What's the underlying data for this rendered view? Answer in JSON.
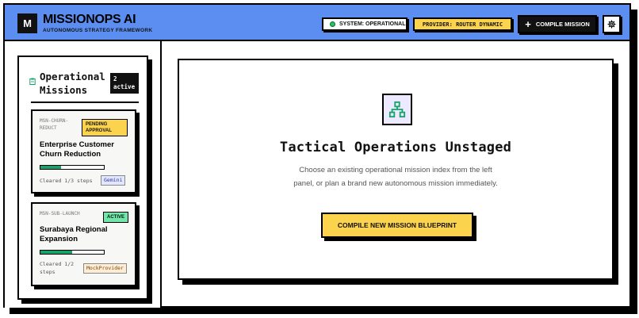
{
  "app": {
    "logo_letter": "M",
    "title": "MISSIONOPS AI",
    "subtitle": "AUTONOMOUS STRATEGY FRAMEWORK"
  },
  "header": {
    "system_status": "SYSTEM: OPERATIONAL",
    "provider": "PROVIDER: ROUTER DYNAMIC",
    "compile_label": "COMPILE MISSION",
    "settings_icon": "gear-icon"
  },
  "sidebar": {
    "title": "Operational Missions",
    "active_count": "2",
    "active_label": "active",
    "missions": [
      {
        "id": "MSN-CHURN-REDUCT",
        "badge": "PENDING APPROVAL",
        "badge_color": "#fcd34d",
        "title": "Enterprise Customer Churn Reduction",
        "progress": 0.33,
        "steps": "Cleared 1/3 steps",
        "provider": "Gemini",
        "provider_color": "#e0e7ff"
      },
      {
        "id": "MSN-SUB-LAUNCH",
        "badge": "ACTIVE",
        "badge_color": "#6ee7a8",
        "title": "Surabaya Regional Expansion",
        "progress": 0.5,
        "steps": "Cleared 1/2 steps",
        "provider": "MockProvider",
        "provider_color": "#ffedd5"
      }
    ]
  },
  "main": {
    "empty_icon": "hierarchy-icon",
    "empty_title": "Tactical Operations Unstaged",
    "empty_description": "Choose an existing operational mission index from the left panel, or plan a brand new autonomous mission immediately.",
    "cta_label": "COMPILE NEW MISSION BLUEPRINT"
  },
  "colors": {
    "header_bg": "#5b8ef0",
    "accent_yellow": "#fcd34d",
    "status_green": "#22c55e",
    "progress_green": "#16a36a"
  }
}
